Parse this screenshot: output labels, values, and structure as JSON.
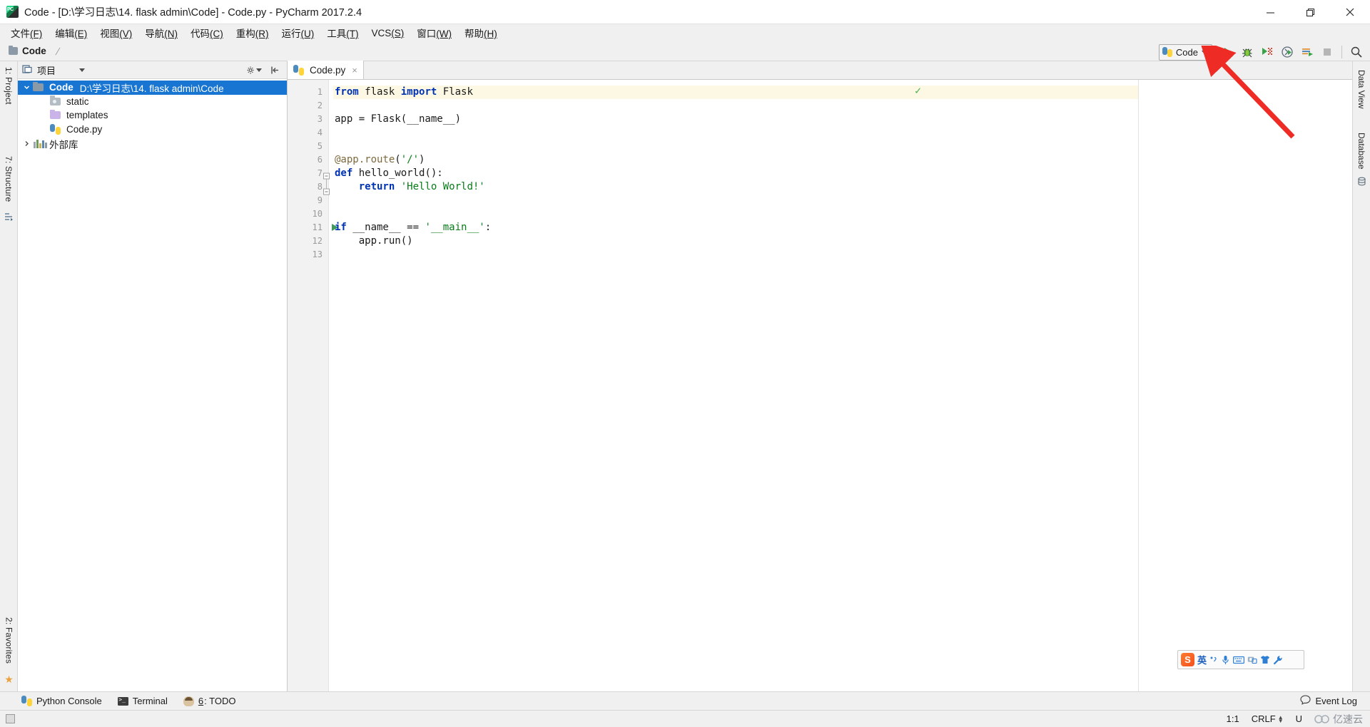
{
  "window": {
    "title": "Code - [D:\\学习日志\\14. flask admin\\Code] - Code.py - PyCharm 2017.2.4",
    "minimize_label": "Minimize",
    "maximize_label": "Restore",
    "close_label": "Close"
  },
  "menubar": [
    {
      "label": "文件",
      "mnemonic": "(F)"
    },
    {
      "label": "编辑",
      "mnemonic": "(E)"
    },
    {
      "label": "视图",
      "mnemonic": "(V)"
    },
    {
      "label": "导航",
      "mnemonic": "(N)"
    },
    {
      "label": "代码",
      "mnemonic": "(C)"
    },
    {
      "label": "重构",
      "mnemonic": "(R)"
    },
    {
      "label": "运行",
      "mnemonic": "(U)"
    },
    {
      "label": "工具",
      "mnemonic": "(T)"
    },
    {
      "label": "VCS",
      "mnemonic": "(S)"
    },
    {
      "label": "窗口",
      "mnemonic": "(W)"
    },
    {
      "label": "帮助",
      "mnemonic": "(H)"
    }
  ],
  "navbar": {
    "crumb": "Code"
  },
  "toolbar": {
    "run_config": "Code",
    "run_label": "Run",
    "debug_label": "Debug",
    "coverage_label": "Run with Coverage",
    "profile_label": "Profile",
    "attach_label": "Attach to Process",
    "stop_label": "Stop",
    "search_label": "Search Everywhere"
  },
  "left_rail": {
    "project_tab": "1: Project",
    "structure_tab": "7: Structure",
    "favorites_tab": "2: Favorites"
  },
  "right_rail": {
    "dataview_tab": "Data View",
    "database_tab": "Database"
  },
  "project": {
    "header_title": "项目",
    "settings_label": "Settings",
    "collapse_label": "Collapse All",
    "tree": [
      {
        "name": "Code",
        "path": "D:\\学习日志\\14. flask admin\\Code",
        "icon": "folder-blue",
        "depth": 0,
        "expanded": true,
        "selected": true,
        "bold": true
      },
      {
        "name": "static",
        "path": "",
        "icon": "folder-static",
        "depth": 1,
        "expanded": null,
        "selected": false,
        "bold": false
      },
      {
        "name": "templates",
        "path": "",
        "icon": "folder-purple",
        "depth": 1,
        "expanded": null,
        "selected": false,
        "bold": false
      },
      {
        "name": "Code.py",
        "path": "",
        "icon": "python-file",
        "depth": 1,
        "expanded": null,
        "selected": false,
        "bold": false
      },
      {
        "name": "外部库",
        "path": "",
        "icon": "library-bars",
        "depth": 0,
        "expanded": false,
        "selected": false,
        "bold": false
      }
    ]
  },
  "editor": {
    "tab_label": "Code.py",
    "tab_close": "×",
    "inspection_ok": "✓",
    "lines": [
      {
        "n": "1",
        "code": "from flask import Flask",
        "highlight": true,
        "run_marker": false
      },
      {
        "n": "2",
        "code": "",
        "highlight": false,
        "run_marker": false
      },
      {
        "n": "3",
        "code": "app = Flask(__name__)",
        "highlight": false,
        "run_marker": false
      },
      {
        "n": "4",
        "code": "",
        "highlight": false,
        "run_marker": false
      },
      {
        "n": "5",
        "code": "",
        "highlight": false,
        "run_marker": false
      },
      {
        "n": "6",
        "code": "@app.route('/')",
        "highlight": false,
        "run_marker": false
      },
      {
        "n": "7",
        "code": "def hello_world():",
        "highlight": false,
        "run_marker": false
      },
      {
        "n": "8",
        "code": "    return 'Hello World!'",
        "highlight": false,
        "run_marker": false
      },
      {
        "n": "9",
        "code": "",
        "highlight": false,
        "run_marker": false
      },
      {
        "n": "10",
        "code": "",
        "highlight": false,
        "run_marker": false
      },
      {
        "n": "11",
        "code": "if __name__ == '__main__':",
        "highlight": false,
        "run_marker": true
      },
      {
        "n": "12",
        "code": "    app.run()",
        "highlight": false,
        "run_marker": false
      },
      {
        "n": "13",
        "code": "",
        "highlight": false,
        "run_marker": false
      }
    ]
  },
  "ime": {
    "logo": "S",
    "mode": "英",
    "voice_label": "Voice Input",
    "keyboard_label": "Soft Keyboard",
    "screenshot_label": "Screenshot",
    "skin_label": "Skin",
    "tools_label": "Toolbox"
  },
  "bottombar": {
    "python_console": "Python Console",
    "terminal": "Terminal",
    "todo_num": "6",
    "todo": ": TODO",
    "event_log": "Event Log"
  },
  "statusbar": {
    "caret": "1:1",
    "line_separator": "CRLF",
    "encoding": "U",
    "watermark": "亿速云"
  },
  "colors": {
    "selection_blue": "#1876d2",
    "accent_green": "#3f9a5e",
    "keyword_blue": "#0033b3",
    "string_green": "#067d17",
    "decorator_gold": "#7f6a3d",
    "highlight_line": "#fdf8e3",
    "annotation_red": "#ee2b24"
  }
}
